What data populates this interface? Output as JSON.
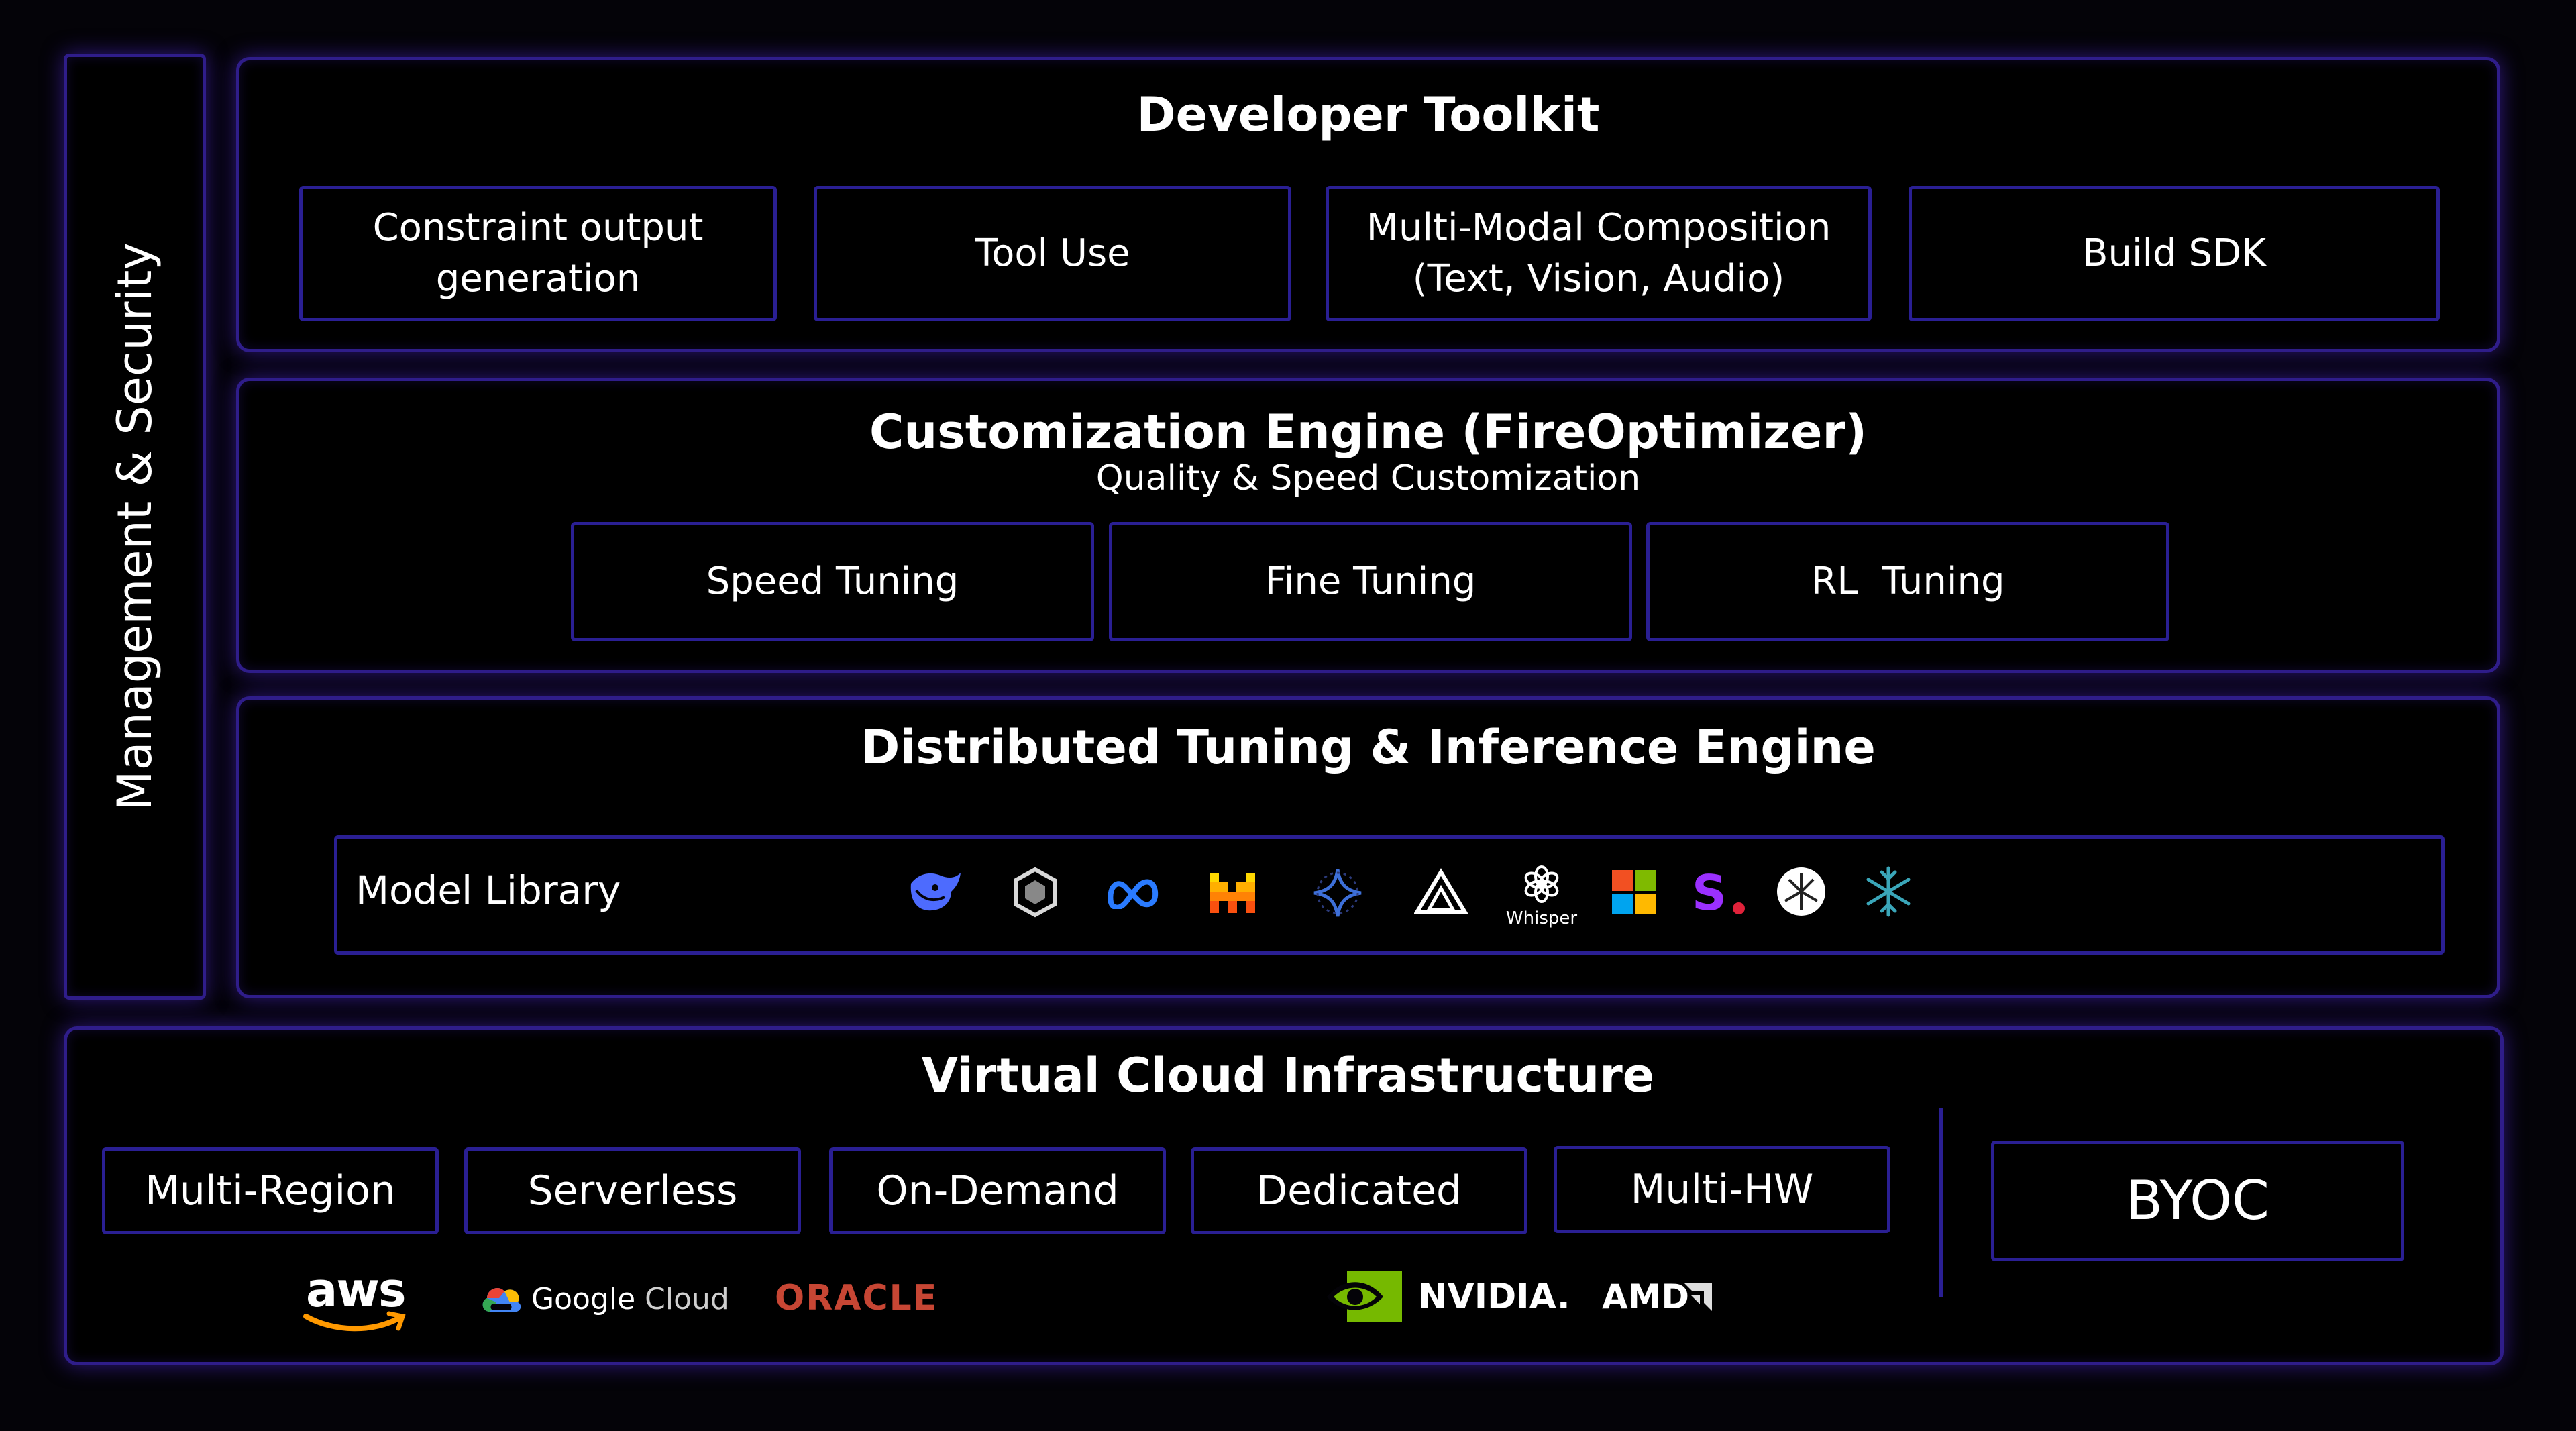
{
  "side": {
    "label": "Management & Security"
  },
  "developer_toolkit": {
    "title": "Developer Toolkit",
    "items": [
      {
        "line1": "Constraint output",
        "line2": "generation"
      },
      {
        "line1": "Tool Use",
        "line2": ""
      },
      {
        "line1": "Multi-Modal Composition",
        "line2": "(Text, Vision, Audio)"
      },
      {
        "line1": "Build SDK",
        "line2": ""
      }
    ]
  },
  "customization": {
    "title": "Customization Engine (FireOptimizer)",
    "subtitle": "Quality & Speed Customization",
    "items": [
      "Speed Tuning",
      "Fine Tuning",
      "RL  Tuning"
    ]
  },
  "distributed": {
    "title": "Distributed Tuning & Inference Engine",
    "model_library": {
      "label": "Model Library",
      "whisper_caption": "Whisper",
      "logos": [
        "deepseek-whale-icon",
        "qwen-icon",
        "meta-icon",
        "mistral-icon",
        "gemma-icon",
        "nous-icon",
        "whisper-icon",
        "microsoft-icon",
        "stability-icon",
        "openai-style-icon",
        "snowflake-icon"
      ]
    }
  },
  "infrastructure": {
    "title": "Virtual Cloud Infrastructure",
    "items": [
      "Multi-Region",
      "Serverless",
      "On-Demand",
      "Dedicated",
      "Multi-HW"
    ],
    "byoc": "BYOC",
    "providers": {
      "aws": "aws",
      "google": "Google",
      "google_cloud": "Cloud",
      "oracle": "ORACLE",
      "nvidia": "NVIDIA.",
      "amd": "AMD"
    },
    "colors": {
      "aws_orange": "#ff9900",
      "oracle_red": "#c74634",
      "nvidia_green": "#76b900"
    }
  },
  "colors": {
    "background": "#040308",
    "border": "#2f1d8a",
    "box_border": "#2a1f93"
  }
}
